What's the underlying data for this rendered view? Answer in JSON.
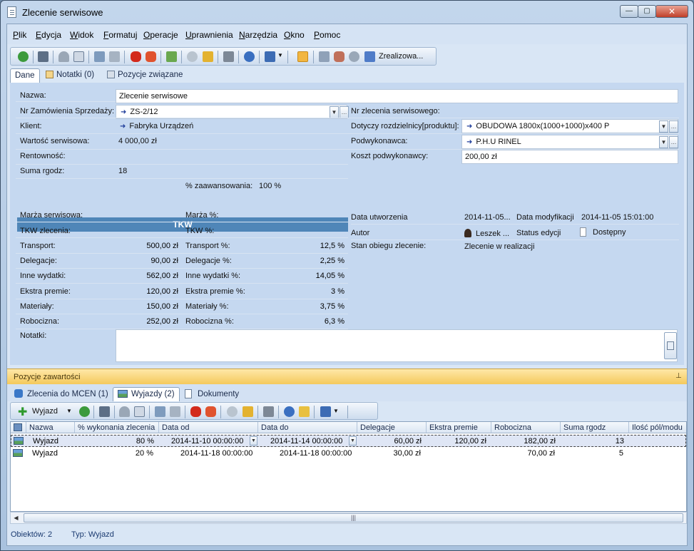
{
  "window": {
    "title": "Zlecenie serwisowe",
    "min": "—",
    "max": "▢",
    "close": "✕"
  },
  "menu": [
    "Plik",
    "Edycja",
    "Widok",
    "Formatuj",
    "Operacje",
    "Uprawnienia",
    "Narzędzia",
    "Okno",
    "Pomoc"
  ],
  "toolbar": {
    "complete_label": "Zrealizowa..."
  },
  "tabs": {
    "main": "Dane",
    "notes": "Notatki (0)",
    "related": "Pozycje związane"
  },
  "form": {
    "name_label": "Nazwa:",
    "name_value": "Zlecenie serwisowe",
    "order_label": "Nr Zamówienia Sprzedaży:",
    "order_value": "ZS-2/12",
    "service_no_label": "Nr zlecenia serwisowego:",
    "client_label": "Klient:",
    "client_value": "Fabryka Urządzeń",
    "concerns_label": "Dotyczy rozdzielnicy[produktu]:",
    "concerns_value": "OBUDOWA 1800x(1000+1000)x400 P",
    "value_label": "Wartość serwisowa:",
    "value_value": "4 000,00 zł",
    "sub_label": "Podwykonawca:",
    "sub_value": "P.H.U RINEL",
    "profit_label": "Rentowność:",
    "subcost_label": "Koszt podwykonawcy:",
    "subcost_value": "200,00 zł",
    "hours_label": "Suma rgodz:",
    "hours_value": "18",
    "progress_label": "% zaawansowania:",
    "progress_value": "100 %",
    "tkw_header": "TKW",
    "margin_label": "Marża serwisowa:",
    "margin_pct_label": "Marża %:",
    "tkw_label": "TKW zlecenia:",
    "tkw_pct_label": "TKW  %:",
    "costs": [
      {
        "label": "Transport:",
        "value": "500,00 zł",
        "pct_label": "Transport %:",
        "pct": "12,5 %"
      },
      {
        "label": "Delegacje:",
        "value": "90,00 zł",
        "pct_label": "Delegacje %:",
        "pct": "2,25 %"
      },
      {
        "label": "Inne wydatki:",
        "value": "562,00 zł",
        "pct_label": "Inne wydatki %:",
        "pct": "14,05 %"
      },
      {
        "label": "Ekstra premie:",
        "value": "120,00 zł",
        "pct_label": "Ekstra premie %:",
        "pct": "3 %"
      },
      {
        "label": "Materiały:",
        "value": "150,00 zł",
        "pct_label": "Materiały %:",
        "pct": "3,75 %"
      },
      {
        "label": "Robocizna:",
        "value": "252,00 zł",
        "pct_label": "Robocizna %:",
        "pct": "6,3 %"
      }
    ],
    "created_label": "Data utworzenia",
    "created_value": "2014-11-05...",
    "modified_label": "Data modyfikacji",
    "modified_value": "2014-11-05 15:01:00",
    "author_label": "Autor",
    "author_value": "Leszek ...",
    "edit_status_label": "Status edycji",
    "edit_status_value": "Dostępny",
    "workflow_label": "Stan obiegu zlecenie:",
    "workflow_value": "Zlecenie w realizacji",
    "notes_label": "Notatki:"
  },
  "bottom": {
    "header": "Pozycje zawartości",
    "tabs": [
      "Zlecenia do MCEN (1)",
      "Wyjazdy (2)",
      "Dokumenty"
    ],
    "add_label": "Wyjazd",
    "columns": [
      "Nazwa",
      "% wykonania zlecenia",
      "Data od",
      "Data do",
      "Delegacje",
      "Ekstra premie",
      "Robocizna",
      "Suma rgodz",
      "Ilość pól/modu"
    ],
    "rows": [
      [
        "Wyjazd",
        "80 %",
        "2014-11-10 00:00:00",
        "2014-11-14 00:00:00",
        "60,00 zł",
        "120,00 zł",
        "182,00 zł",
        "13"
      ],
      [
        "Wyjazd",
        "20 %",
        "2014-11-18 00:00:00",
        "2014-11-18 00:00:00",
        "30,00 zł",
        "",
        "70,00 zł",
        "5"
      ]
    ]
  },
  "status": {
    "count": "Obiektów: 2",
    "type": "Typ: Wyjazd"
  }
}
